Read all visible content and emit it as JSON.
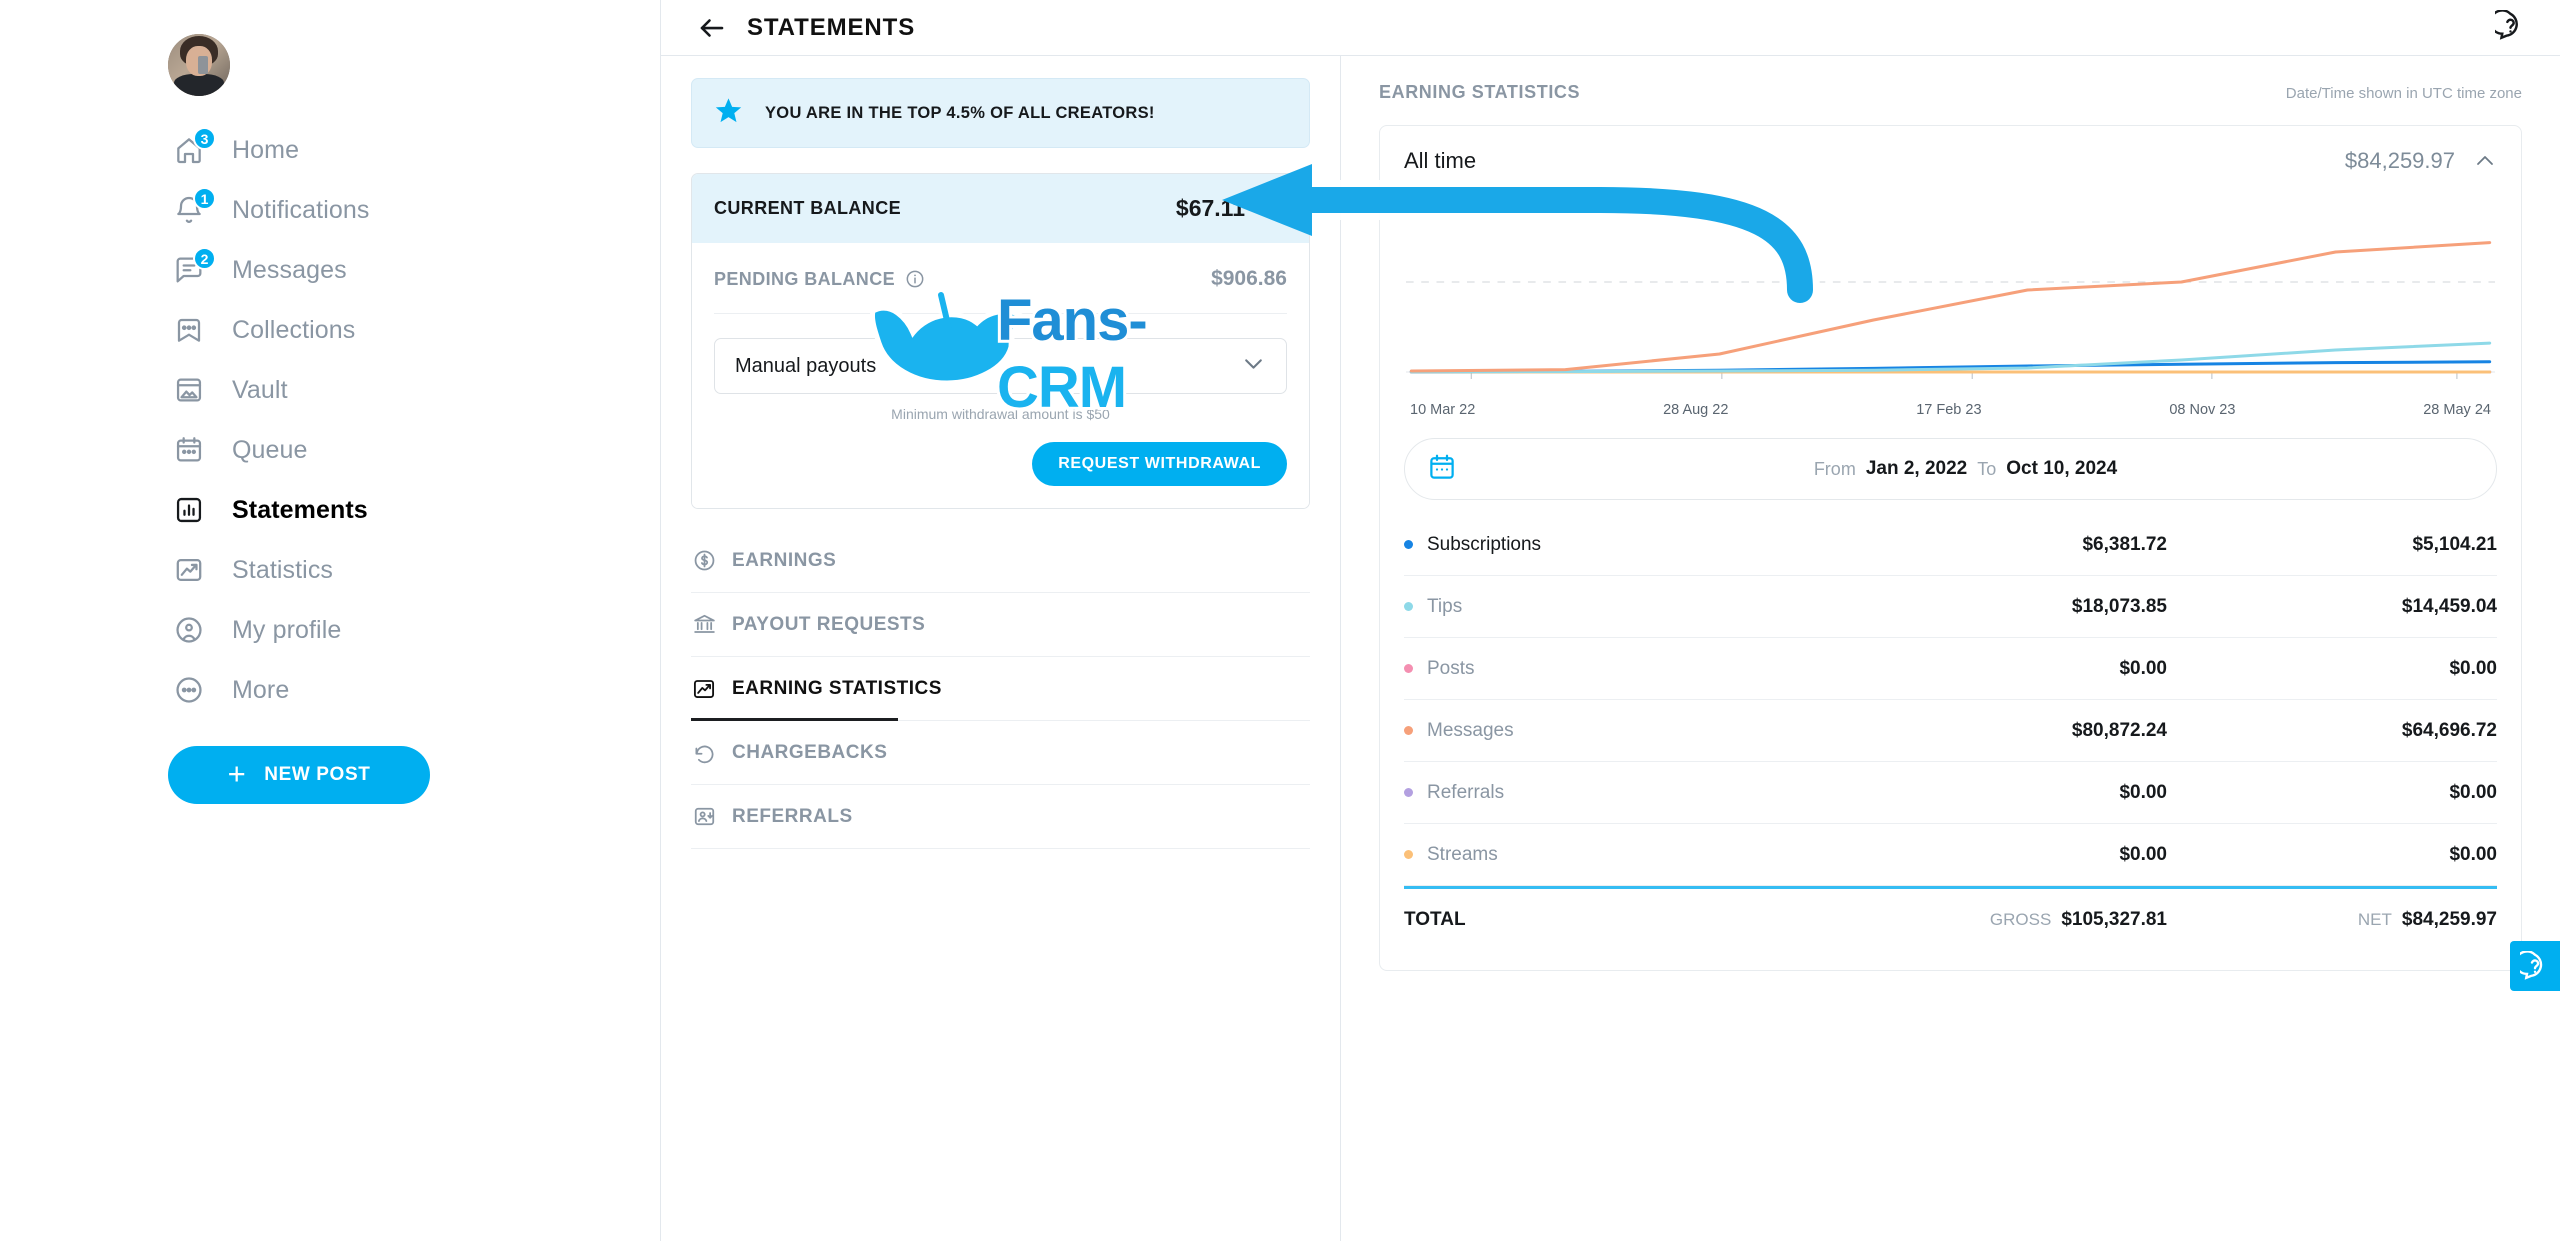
{
  "sidebar": {
    "avatar_alt": "user-avatar",
    "items": [
      {
        "label": "Home",
        "icon": "home-icon",
        "badge": "3",
        "active": false
      },
      {
        "label": "Notifications",
        "icon": "bell-icon",
        "badge": "1",
        "active": false
      },
      {
        "label": "Messages",
        "icon": "chat-icon",
        "badge": "2",
        "active": false
      },
      {
        "label": "Collections",
        "icon": "bookmark-stars-icon",
        "badge": "",
        "active": false
      },
      {
        "label": "Vault",
        "icon": "image-box-icon",
        "badge": "",
        "active": false
      },
      {
        "label": "Queue",
        "icon": "calendar-icon",
        "badge": "",
        "active": false
      },
      {
        "label": "Statements",
        "icon": "bar-chart-box-icon",
        "badge": "",
        "active": true
      },
      {
        "label": "Statistics",
        "icon": "trend-image-icon",
        "badge": "",
        "active": false
      },
      {
        "label": "My profile",
        "icon": "person-circle-icon",
        "badge": "",
        "active": false
      },
      {
        "label": "More",
        "icon": "ellipsis-circle-icon",
        "badge": "",
        "active": false
      }
    ],
    "new_post_label": "NEW POST"
  },
  "topbar": {
    "title": "STATEMENTS",
    "back_icon": "back-arrow-icon",
    "help_icon": "help-icon"
  },
  "middle": {
    "promo": {
      "icon": "star-icon",
      "text": "YOU ARE IN THE TOP 4.5% OF ALL CREATORS!"
    },
    "balance": {
      "label": "CURRENT BALANCE",
      "value": "$67.11",
      "chevron": "chevron-up-icon",
      "pending_label": "PENDING BALANCE",
      "pending_info_icon": "info-icon",
      "pending_value": "$906.86",
      "payout_select": "Manual payouts",
      "payout_select_chevron": "chevron-down-icon",
      "min_note": "Minimum withdrawal amount is $50",
      "withdraw_label": "REQUEST WITHDRAWAL"
    },
    "tabs": [
      {
        "label": "EARNINGS",
        "icon": "dollar-circle-icon",
        "active": false
      },
      {
        "label": "PAYOUT REQUESTS",
        "icon": "bank-icon",
        "active": false
      },
      {
        "label": "EARNING STATISTICS",
        "icon": "trend-image-icon",
        "active": true
      },
      {
        "label": "CHARGEBACKS",
        "icon": "undo-icon",
        "active": false
      },
      {
        "label": "REFERRALS",
        "icon": "person-add-icon",
        "active": false
      }
    ]
  },
  "right": {
    "section_title": "EARNING STATISTICS",
    "timezone_note": "Date/Time shown in UTC time zone",
    "panel": {
      "period_label": "All time",
      "period_amount": "$84,259.97",
      "chevron": "chevron-up-icon"
    },
    "daterange": {
      "calendar_icon": "calendar-icon",
      "from_label": "From",
      "from_value": "Jan 2, 2022",
      "to_label": "To",
      "to_value": "Oct 10, 2024"
    },
    "table": {
      "rows": [
        {
          "name": "Subscriptions",
          "color": "#1784e3",
          "gross": "$6,381.72",
          "net": "$5,104.21"
        },
        {
          "name": "Tips",
          "color": "#8ed9e8",
          "gross": "$18,073.85",
          "net": "$14,459.04"
        },
        {
          "name": "Posts",
          "color": "#f48fb1",
          "gross": "$0.00",
          "net": "$0.00"
        },
        {
          "name": "Messages",
          "color": "#f6a07a",
          "gross": "$80,872.24",
          "net": "$64,696.72"
        },
        {
          "name": "Referrals",
          "color": "#b3a0e0",
          "gross": "$0.00",
          "net": "$0.00"
        },
        {
          "name": "Streams",
          "color": "#fbc078",
          "gross": "$0.00",
          "net": "$0.00"
        }
      ],
      "total_label": "TOTAL",
      "gross_tag": "GROSS",
      "gross_total": "$105,327.81",
      "net_tag": "NET",
      "net_total": "$84,259.97"
    }
  },
  "watermark": {
    "text_fans": "Fans",
    "text_sep": "-",
    "text_crm": "CRM",
    "logo_icon": "fanscrm-wings-icon"
  },
  "fab": {
    "icon": "help-icon"
  },
  "chart_data": {
    "type": "line",
    "title": "All time",
    "xlabel": "",
    "ylabel": "",
    "grid": true,
    "legend_position": "below-as-table",
    "x_ticks": [
      "10 Mar 22",
      "28 Aug 22",
      "17 Feb 23",
      "08 Nov 23",
      "28 May 24"
    ],
    "x_range": [
      "Jan 2, 2022",
      "Oct 10, 2024"
    ],
    "y_range": [
      0,
      90000
    ],
    "series": [
      {
        "name": "Messages",
        "color": "#f6a07a",
        "x": [
          "10 Mar 22",
          "28 Aug 22",
          "17 Feb 23",
          "01 Jun 23",
          "08 Nov 23",
          "10 Feb 24",
          "28 May 24",
          "10 Oct 24"
        ],
        "values": [
          500,
          1200,
          9000,
          26000,
          41000,
          45000,
          60000,
          64700
        ]
      },
      {
        "name": "Tips",
        "color": "#8ed9e8",
        "x": [
          "10 Mar 22",
          "28 Aug 22",
          "17 Feb 23",
          "01 Jun 23",
          "08 Nov 23",
          "10 Feb 24",
          "28 May 24",
          "10 Oct 24"
        ],
        "values": [
          100,
          200,
          500,
          900,
          2000,
          6000,
          11000,
          14459
        ]
      },
      {
        "name": "Subscriptions",
        "color": "#1784e3",
        "x": [
          "10 Mar 22",
          "28 Aug 22",
          "17 Feb 23",
          "01 Jun 23",
          "08 Nov 23",
          "10 Feb 24",
          "28 May 24",
          "10 Oct 24"
        ],
        "values": [
          80,
          300,
          900,
          1800,
          3000,
          3900,
          4700,
          5104
        ]
      },
      {
        "name": "Posts",
        "color": "#e8717f",
        "x": [
          "10 Mar 22",
          "28 Aug 22",
          "17 Feb 23",
          "01 Jun 23",
          "08 Nov 23",
          "10 Feb 24",
          "28 May 24",
          "10 Oct 24"
        ],
        "values": [
          0,
          0,
          0,
          0,
          0,
          0,
          0,
          0
        ]
      },
      {
        "name": "Referrals",
        "color": "#b3a0e0",
        "x": [
          "10 Mar 22",
          "28 Aug 22",
          "17 Feb 23",
          "01 Jun 23",
          "08 Nov 23",
          "10 Feb 24",
          "28 May 24",
          "10 Oct 24"
        ],
        "values": [
          0,
          0,
          0,
          0,
          0,
          0,
          0,
          0
        ]
      },
      {
        "name": "Streams",
        "color": "#fbc078",
        "x": [
          "10 Mar 22",
          "28 Aug 22",
          "17 Feb 23",
          "01 Jun 23",
          "08 Nov 23",
          "10 Feb 24",
          "28 May 24",
          "10 Oct 24"
        ],
        "values": [
          0,
          0,
          0,
          0,
          0,
          0,
          0,
          0
        ]
      }
    ]
  }
}
